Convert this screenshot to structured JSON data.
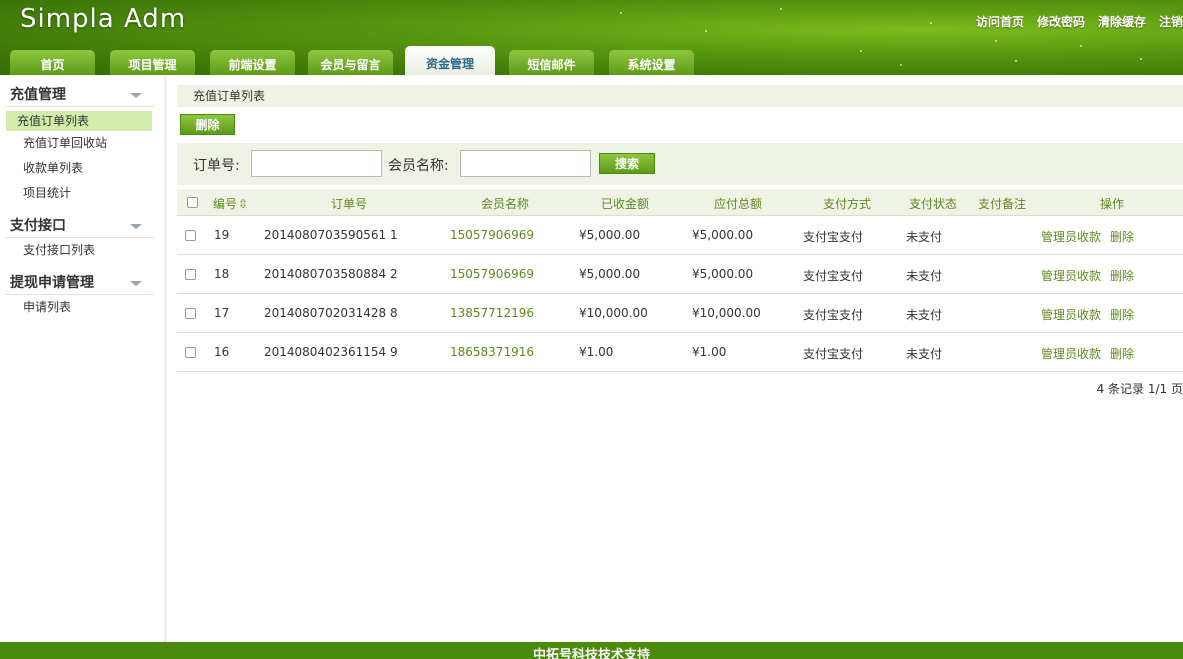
{
  "header": {
    "logo": "Simpla Admi",
    "links": [
      "访问首页",
      "修改密码",
      "清除缓存",
      "注销"
    ],
    "tabs": [
      {
        "label": "首页"
      },
      {
        "label": "项目管理"
      },
      {
        "label": "前端设置"
      },
      {
        "label": "会员与留言"
      },
      {
        "label": "资金管理",
        "active": true
      },
      {
        "label": "短信邮件"
      },
      {
        "label": "系统设置"
      }
    ]
  },
  "sidebar": {
    "groups": [
      {
        "title": "充值管理",
        "items": [
          "充值订单列表",
          "充值订单回收站",
          "收款单列表",
          "项目统计"
        ]
      },
      {
        "title": "支付接口",
        "items": [
          "支付接口列表"
        ]
      },
      {
        "title": "提现申请管理",
        "items": [
          "申请列表"
        ]
      }
    ]
  },
  "main": {
    "breadcrumb": "充值订单列表",
    "delete_button": "删除",
    "search": {
      "order_label": "订单号:",
      "order_value": "",
      "member_label": "会员名称:",
      "member_value": "",
      "button": "搜索"
    },
    "columns": [
      "编号",
      "订单号",
      "会员名称",
      "已收金额",
      "应付总额",
      "支付方式",
      "支付状态",
      "支付备注",
      "操作"
    ],
    "rows": [
      {
        "id": "19",
        "order": "2014080703590561 1",
        "member": "15057906969",
        "received": "¥5,000.00",
        "total": "¥5,000.00",
        "method": "支付宝支付",
        "status": "未支付",
        "note": "",
        "action1": "管理员收款",
        "action2": "删除"
      },
      {
        "id": "18",
        "order": "2014080703580884 2",
        "member": "15057906969",
        "received": "¥5,000.00",
        "total": "¥5,000.00",
        "method": "支付宝支付",
        "status": "未支付",
        "note": "",
        "action1": "管理员收款",
        "action2": "删除"
      },
      {
        "id": "17",
        "order": "2014080702031428 8",
        "member": "13857712196",
        "received": "¥10,000.00",
        "total": "¥10,000.00",
        "method": "支付宝支付",
        "status": "未支付",
        "note": "",
        "action1": "管理员收款",
        "action2": "删除"
      },
      {
        "id": "16",
        "order": "2014080402361154 9",
        "member": "18658371916",
        "received": "¥1.00",
        "total": "¥1.00",
        "method": "支付宝支付",
        "status": "未支付",
        "note": "",
        "action1": "管理员收款",
        "action2": "删除"
      }
    ],
    "pager": "4 条记录 1/1 页"
  },
  "footer": {
    "text": "中拓号科技技术支持"
  }
}
